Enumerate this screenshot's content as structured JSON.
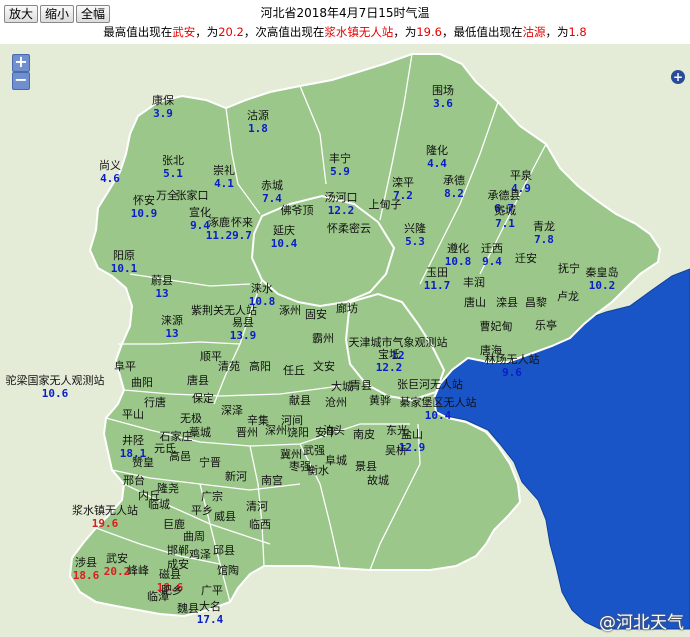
{
  "toolbar": {
    "zoom_in_label": "放大",
    "zoom_out_label": "缩小",
    "full_label": "全幅"
  },
  "header": {
    "title": "河北省2018年4月7日15时气温",
    "sub_1": "最高值出现在",
    "max_station": "武安",
    "sub_2": "，为",
    "max_value": "20.2",
    "sub_3": "，次高值出现在",
    "second_station": "浆水镇无人站",
    "sub_4": "，为",
    "second_value": "19.6",
    "sub_5": "，最低值出现在",
    "min_station": "沽源",
    "sub_6": "，为",
    "min_value": "1.8"
  },
  "map": {
    "zoom_plus": "+",
    "zoom_minus": "−",
    "pan_symbol": "+",
    "watermark": "@河北天气"
  },
  "colors": {
    "land": "#9bc78a",
    "sea": "#1a55c8",
    "label_blue": "#0a1ec8",
    "label_red": "#d81e1e",
    "border": "#ffffff"
  },
  "labels": [
    {
      "name": "康保",
      "value": "3.9",
      "hot": false
    },
    {
      "name": "沽源",
      "value": "1.8",
      "hot": false
    },
    {
      "name": "围场",
      "value": "3.6",
      "hot": false
    },
    {
      "name": "尚义",
      "value": "4.6",
      "hot": false
    },
    {
      "name": "张北",
      "value": "5.1",
      "hot": false
    },
    {
      "name": "崇礼",
      "value": "4.1",
      "hot": false
    },
    {
      "name": "丰宁",
      "value": "5.9",
      "hot": false
    },
    {
      "name": "隆化",
      "value": "4.4",
      "hot": false
    },
    {
      "name": "平泉",
      "value": "4.9",
      "hot": false
    },
    {
      "name": "赤城",
      "value": "7.4",
      "hot": false
    },
    {
      "name": "滦平",
      "value": "7.2",
      "hot": false
    },
    {
      "name": "承德",
      "value": "8.2",
      "hot": false
    },
    {
      "name": "承德县",
      "value": "6.7",
      "hot": false
    },
    {
      "name": "宽城",
      "value": "7.1",
      "hot": false
    },
    {
      "name": "青龙",
      "value": "7.8",
      "hot": false
    },
    {
      "name": "万全",
      "value": "",
      "hot": false
    },
    {
      "name": "张家口",
      "value": "",
      "hot": false
    },
    {
      "name": "怀安",
      "value": "10.9",
      "hot": false
    },
    {
      "name": "宣化",
      "value": "9.4",
      "hot": false
    },
    {
      "name": "涿鹿",
      "value": "11.2",
      "hot": false
    },
    {
      "name": "怀来",
      "value": "9.7",
      "hot": false
    },
    {
      "name": "佛爷顶",
      "value": "",
      "hot": false
    },
    {
      "name": "延庆",
      "value": "10.4",
      "hot": false
    },
    {
      "name": "汤河口",
      "value": "12.2",
      "hot": false
    },
    {
      "name": "上甸子",
      "value": "",
      "hot": false
    },
    {
      "name": "怀柔",
      "value": "",
      "hot": false
    },
    {
      "name": "密云",
      "value": "",
      "hot": false
    },
    {
      "name": "兴隆",
      "value": "5.3",
      "hot": false
    },
    {
      "name": "阳原",
      "value": "10.1",
      "hot": false
    },
    {
      "name": "蔚县",
      "value": "13",
      "hot": false
    },
    {
      "name": "遵化",
      "value": "10.8",
      "hot": false
    },
    {
      "name": "迁西",
      "value": "9.4",
      "hot": false
    },
    {
      "name": "迁安",
      "value": "",
      "hot": false
    },
    {
      "name": "抚宁",
      "value": "",
      "hot": false
    },
    {
      "name": "秦皇岛",
      "value": "10.2",
      "hot": false
    },
    {
      "name": "玉田",
      "value": "11.7",
      "hot": false
    },
    {
      "name": "丰润",
      "value": "",
      "hot": false
    },
    {
      "name": "唐山",
      "value": "",
      "hot": false
    },
    {
      "name": "滦县",
      "value": "",
      "hot": false
    },
    {
      "name": "昌黎",
      "value": "",
      "hot": false
    },
    {
      "name": "卢龙",
      "value": "",
      "hot": false
    },
    {
      "name": "乐亭",
      "value": "",
      "hot": false
    },
    {
      "name": "涞水",
      "value": "10.8",
      "hot": false
    },
    {
      "name": "涞源",
      "value": "13",
      "hot": false
    },
    {
      "name": "紫荆关无人站",
      "value": "",
      "hot": false
    },
    {
      "name": "易县",
      "value": "13.9",
      "hot": false
    },
    {
      "name": "涿州",
      "value": "",
      "hot": false
    },
    {
      "name": "固安",
      "value": "",
      "hot": false
    },
    {
      "name": "廊坊",
      "value": "",
      "hot": false
    },
    {
      "name": "霸州",
      "value": "",
      "hot": false
    },
    {
      "name": "天津城市气象观测站",
      "value": "12",
      "hot": false
    },
    {
      "name": "宝坻",
      "value": "12.2",
      "hot": false
    },
    {
      "name": "曹妃甸",
      "value": "",
      "hot": false
    },
    {
      "name": "唐海",
      "value": "",
      "hot": false
    },
    {
      "name": "林场无人站",
      "value": "9.6",
      "hot": false
    },
    {
      "name": "驼梁国家无人观测站",
      "value": "10.6",
      "hot": false
    },
    {
      "name": "阜平",
      "value": "",
      "hot": false
    },
    {
      "name": "曲阳",
      "value": "",
      "hot": false
    },
    {
      "name": "唐县",
      "value": "",
      "hot": false
    },
    {
      "name": "顺平",
      "value": "",
      "hot": false
    },
    {
      "name": "保定",
      "value": "",
      "hot": false
    },
    {
      "name": "清苑",
      "value": "",
      "hot": false
    },
    {
      "name": "高阳",
      "value": "",
      "hot": false
    },
    {
      "name": "任丘",
      "value": "",
      "hot": false
    },
    {
      "name": "文安",
      "value": "",
      "hot": false
    },
    {
      "name": "大城",
      "value": "",
      "hot": false
    },
    {
      "name": "青县",
      "value": "",
      "hot": false
    },
    {
      "name": "黄骅",
      "value": "",
      "hot": false
    },
    {
      "name": "张巨河无人站",
      "value": "",
      "hot": false
    },
    {
      "name": "綦家堡区无人站",
      "value": "10.4",
      "hot": false
    },
    {
      "name": "沧州",
      "value": "",
      "hot": false
    },
    {
      "name": "泊头",
      "value": "",
      "hot": false
    },
    {
      "name": "南皮",
      "value": "",
      "hot": false
    },
    {
      "name": "盐山",
      "value": "12.9",
      "hot": false
    },
    {
      "name": "东光",
      "value": "",
      "hot": false
    },
    {
      "name": "吴桥",
      "value": "",
      "hot": false
    },
    {
      "name": "献县",
      "value": "",
      "hot": false
    },
    {
      "name": "河间",
      "value": "",
      "hot": false
    },
    {
      "name": "平山",
      "value": "",
      "hot": false
    },
    {
      "name": "井陉",
      "value": "18.1",
      "hot": false
    },
    {
      "name": "行唐",
      "value": "",
      "hot": false
    },
    {
      "name": "无极",
      "value": "",
      "hot": false
    },
    {
      "name": "深泽",
      "value": "",
      "hot": false
    },
    {
      "name": "石家庄",
      "value": "",
      "hot": false
    },
    {
      "name": "藁城",
      "value": "",
      "hot": false
    },
    {
      "name": "晋州",
      "value": "",
      "hot": false
    },
    {
      "name": "辛集",
      "value": "",
      "hot": false
    },
    {
      "name": "深州",
      "value": "",
      "hot": false
    },
    {
      "name": "武强",
      "value": "",
      "hot": false
    },
    {
      "name": "饶阳",
      "value": "",
      "hot": false
    },
    {
      "name": "安平",
      "value": "",
      "hot": false
    },
    {
      "name": "衡水",
      "value": "",
      "hot": false
    },
    {
      "name": "阜城",
      "value": "",
      "hot": false
    },
    {
      "name": "景县",
      "value": "",
      "hot": false
    },
    {
      "name": "故城",
      "value": "",
      "hot": false
    },
    {
      "name": "枣强",
      "value": "",
      "hot": false
    },
    {
      "name": "冀州",
      "value": "",
      "hot": false
    },
    {
      "name": "赞皇",
      "value": "",
      "hot": false
    },
    {
      "name": "元氏",
      "value": "",
      "hot": false
    },
    {
      "name": "高邑",
      "value": "",
      "hot": false
    },
    {
      "name": "宁晋",
      "value": "",
      "hot": false
    },
    {
      "name": "新河",
      "value": "",
      "hot": false
    },
    {
      "name": "南宫",
      "value": "",
      "hot": false
    },
    {
      "name": "清河",
      "value": "",
      "hot": false
    },
    {
      "name": "临西",
      "value": "",
      "hot": false
    },
    {
      "name": "邢台",
      "value": "",
      "hot": false
    },
    {
      "name": "内丘",
      "value": "",
      "hot": false
    },
    {
      "name": "临城",
      "value": "",
      "hot": false
    },
    {
      "name": "隆尧",
      "value": "",
      "hot": false
    },
    {
      "name": "巨鹿",
      "value": "",
      "hot": false
    },
    {
      "name": "平乡",
      "value": "",
      "hot": false
    },
    {
      "name": "广宗",
      "value": "",
      "hot": false
    },
    {
      "name": "威县",
      "value": "",
      "hot": false
    },
    {
      "name": "浆水镇无人站",
      "value": "19.6",
      "hot": true
    },
    {
      "name": "武安",
      "value": "20.2",
      "hot": true
    },
    {
      "name": "涉县",
      "value": "18.6",
      "hot": true
    },
    {
      "name": "磁县",
      "value": "18.6",
      "hot": true
    },
    {
      "name": "峰峰",
      "value": "",
      "hot": false
    },
    {
      "name": "成安",
      "value": "",
      "hot": false
    },
    {
      "name": "肥乡",
      "value": "",
      "hot": false
    },
    {
      "name": "邯郸",
      "value": "",
      "hot": false
    },
    {
      "name": "曲周",
      "value": "",
      "hot": false
    },
    {
      "name": "鸡泽",
      "value": "",
      "hot": false
    },
    {
      "name": "馆陶",
      "value": "",
      "hot": false
    },
    {
      "name": "广平",
      "value": "",
      "hot": false
    },
    {
      "name": "大名",
      "value": "17.4",
      "hot": false
    },
    {
      "name": "魏县",
      "value": "",
      "hot": false
    },
    {
      "name": "临漳",
      "value": "",
      "hot": false
    },
    {
      "name": "邱县",
      "value": "",
      "hot": false
    }
  ]
}
